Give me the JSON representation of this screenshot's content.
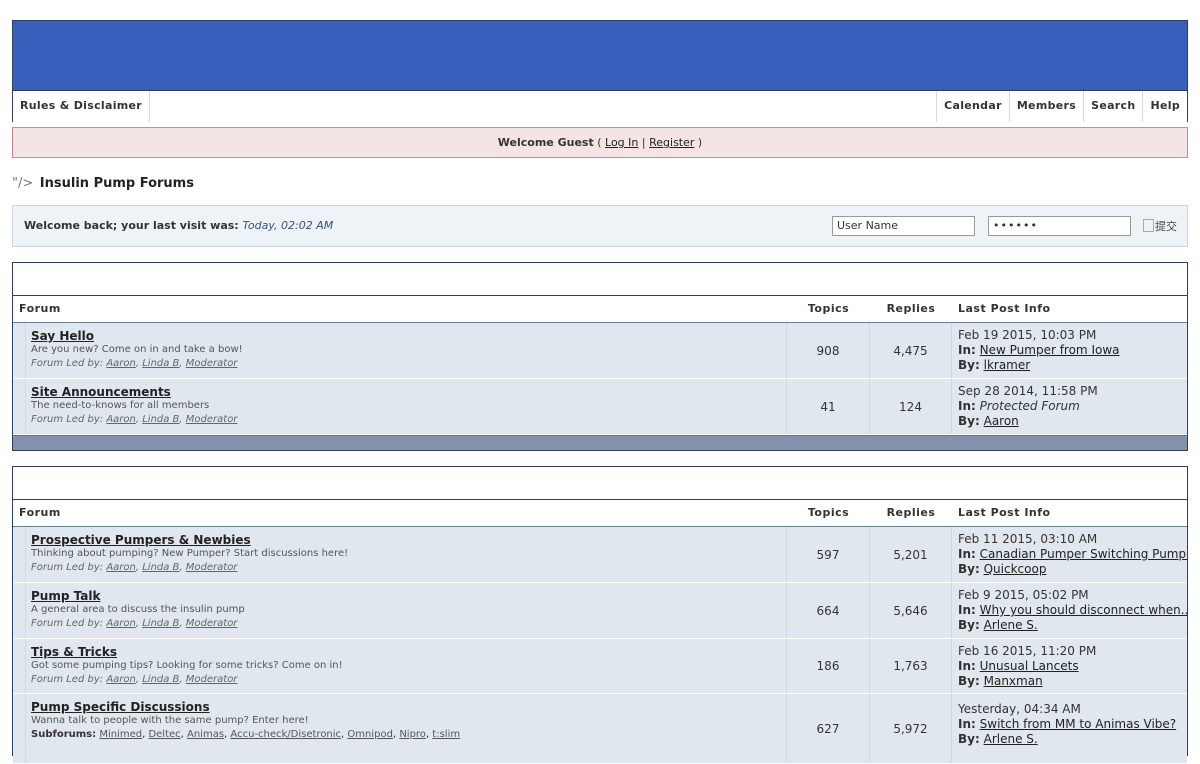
{
  "nav": {
    "left": [
      "Rules & Disclaimer"
    ],
    "right": [
      "Calendar",
      "Members",
      "Search",
      "Help"
    ]
  },
  "guest": {
    "welcome": "Welcome Guest",
    "open": "(",
    "login": "Log In",
    "sep": "|",
    "register": "Register",
    "close": ")"
  },
  "breadcrumb": {
    "prefix": "\"/>",
    "title": "Insulin Pump Forums"
  },
  "login_bar": {
    "label": "Welcome back; your last visit was:",
    "last_visit": "Today, 02:02 AM",
    "username_placeholder": "User Name",
    "password_value": "••••••",
    "submit_alt": "提交"
  },
  "columns": {
    "forum": "Forum",
    "topics": "Topics",
    "replies": "Replies",
    "last_post": "Last Post Info"
  },
  "labels": {
    "led_by": "Forum Led by:",
    "in": "In:",
    "by": "By:",
    "subforums": "Subforums:"
  },
  "categories": [
    {
      "forums": [
        {
          "name": "Say Hello",
          "description": "Are you new? Come on in and take a bow!",
          "leaders": [
            "Aaron",
            "Linda B",
            "Moderator"
          ],
          "topics": "908",
          "replies": "4,475",
          "last_date": "Feb 19 2015, 10:03 PM",
          "last_in": "New Pumper from Iowa",
          "last_by": "lkramer"
        },
        {
          "name": "Site Announcements",
          "description": "The need-to-knows for all members",
          "leaders": [
            "Aaron",
            "Linda B",
            "Moderator"
          ],
          "topics": "41",
          "replies": "124",
          "last_date": "Sep 28 2014, 11:58 PM",
          "last_in": "Protected Forum",
          "last_by": "Aaron"
        }
      ]
    },
    {
      "forums": [
        {
          "name": "Prospective Pumpers & Newbies",
          "description": "Thinking about pumping? New Pumper? Start discussions here!",
          "leaders": [
            "Aaron",
            "Linda B",
            "Moderator"
          ],
          "topics": "597",
          "replies": "5,201",
          "last_date": "Feb 11 2015, 03:10 AM",
          "last_in": "Canadian Pumper Switching Pump...",
          "last_by": "Quickcoop"
        },
        {
          "name": "Pump Talk",
          "description": "A general area to discuss the insulin pump",
          "leaders": [
            "Aaron",
            "Linda B",
            "Moderator"
          ],
          "topics": "664",
          "replies": "5,646",
          "last_date": "Feb 9 2015, 05:02 PM",
          "last_in": "Why you should disconnect when...",
          "last_by": "Arlene S."
        },
        {
          "name": "Tips & Tricks",
          "description": "Got some pumping tips? Looking for some tricks? Come on in!",
          "leaders": [
            "Aaron",
            "Linda B",
            "Moderator"
          ],
          "topics": "186",
          "replies": "1,763",
          "last_date": "Feb 16 2015, 11:20 PM",
          "last_in": "Unusual Lancets",
          "last_by": "Manxman"
        },
        {
          "name": "Pump Specific Discussions",
          "description": "Wanna talk to people with the same pump? Enter here!",
          "subforums": [
            "Minimed",
            "Deltec",
            "Animas",
            "Accu-check/Disetronic",
            "Omnipod",
            "Nipro",
            "t:slim"
          ],
          "topics": "627",
          "replies": "5,972",
          "last_date": "Yesterday, 04:34 AM",
          "last_in": "Switch from MM to Animas Vibe?",
          "last_by": "Arlene S."
        }
      ]
    }
  ]
}
